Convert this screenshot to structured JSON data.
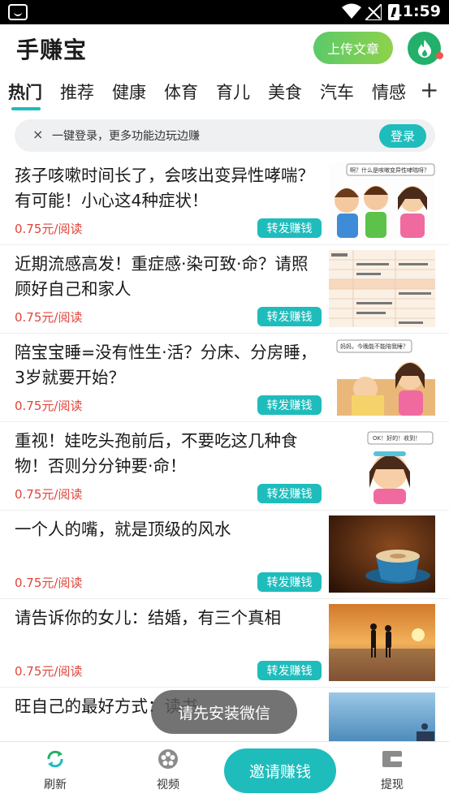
{
  "status_bar": {
    "time": "11:59"
  },
  "header": {
    "brand": "手赚宝",
    "upload_label": "上传文章"
  },
  "tabs": [
    {
      "label": "热门",
      "active": true
    },
    {
      "label": "推荐"
    },
    {
      "label": "健康"
    },
    {
      "label": "体育"
    },
    {
      "label": "育儿"
    },
    {
      "label": "美食"
    },
    {
      "label": "汽车"
    },
    {
      "label": "情感"
    }
  ],
  "tab_add": "+",
  "login_bar": {
    "close": "×",
    "text": "一键登录，更多功能边玩边赚",
    "button": "登录"
  },
  "articles": [
    {
      "title": "孩子咳嗽时间长了，会咳出变异性哮喘？有可能！小心这4种症状！",
      "price": "0.75元/阅读",
      "share": "转发赚钱",
      "thumb_caption": "啊？什么是咳嗽变异性哮喘呀？"
    },
    {
      "title": "近期流感高发！重症感·染可致·命？请照顾好自己和家人",
      "price": "0.75元/阅读",
      "share": "转发赚钱"
    },
    {
      "title": "陪宝宝睡=没有性生·活？分床、分房睡，3岁就要开始？",
      "price": "0.75元/阅读",
      "share": "转发赚钱",
      "thumb_caption": "妈妈，今晚能不能陪我睡？"
    },
    {
      "title": "重视！娃吃头孢前后，不要吃这几种食物！否则分分钟要·命！",
      "price": "0.75元/阅读",
      "share": "转发赚钱",
      "thumb_caption": "OK！好的！收到！"
    },
    {
      "title": "一个人的嘴，就是顶级的风水",
      "price": "0.75元/阅读",
      "share": "转发赚钱"
    },
    {
      "title": "请告诉你的女儿：结婚，有三个真相",
      "price": "0.75元/阅读",
      "share": "转发赚钱"
    },
    {
      "title": "旺自己的最好方式：读书",
      "price": "",
      "share": ""
    }
  ],
  "toast": "请先安装微信",
  "bottom_nav": {
    "refresh": "刷新",
    "video": "视频",
    "invite": "邀请赚钱",
    "withdraw": "提现"
  },
  "colors": {
    "accent": "#1fbcbc",
    "price": "#e0453b",
    "upload": "#6ccf5b",
    "flame": "#22b06a"
  }
}
